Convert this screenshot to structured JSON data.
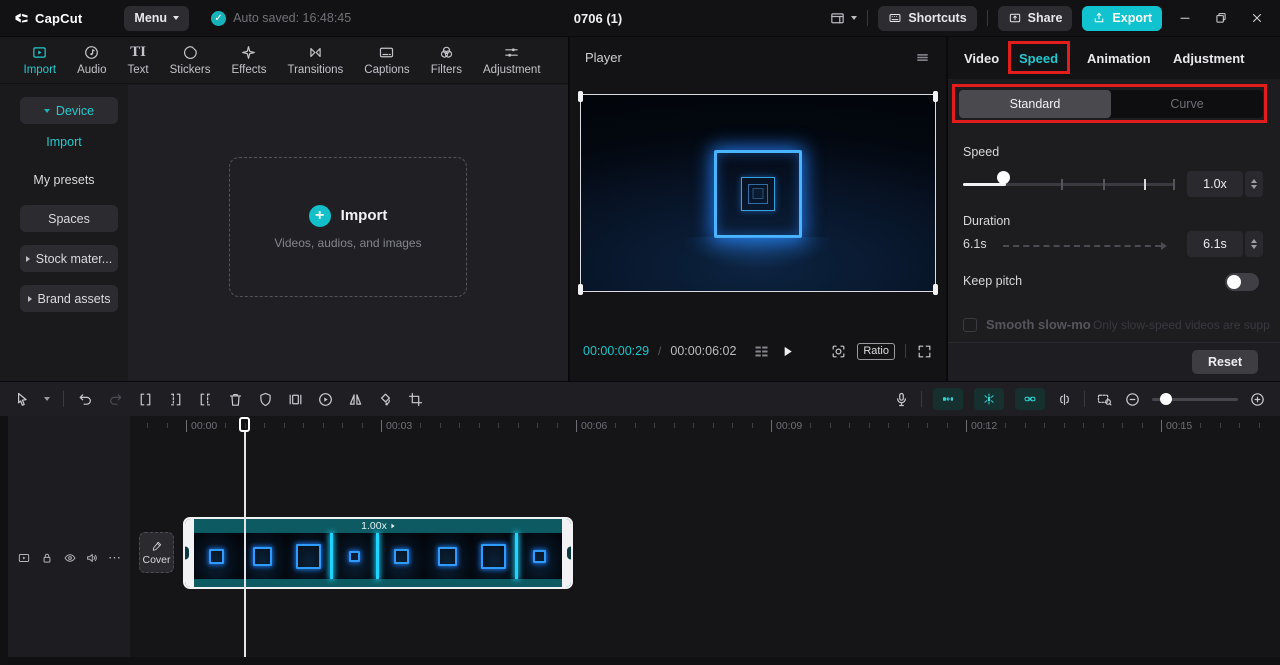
{
  "colors": {
    "accent": "#23c9ce",
    "export_button": "#10c3cf",
    "annotation_red": "#e31c1c",
    "clip_teal": "#0d5a63",
    "neon_blue": "#2f9bff"
  },
  "glyphs": {
    "check": "✓",
    "plus": "+",
    "text_icon": "TI",
    "more": "⋯"
  },
  "topbar": {
    "logo_text": "CapCut",
    "menu_label": "Menu",
    "autosave_text": "Auto saved: 16:48:45",
    "project_title": "0706 (1)",
    "shortcuts_label": "Shortcuts",
    "share_label": "Share",
    "export_label": "Export"
  },
  "media_panel": {
    "tabs": [
      {
        "label": "Import"
      },
      {
        "label": "Audio"
      },
      {
        "label": "Text"
      },
      {
        "label": "Stickers"
      },
      {
        "label": "Effects"
      },
      {
        "label": "Transitions"
      },
      {
        "label": "Captions"
      },
      {
        "label": "Filters"
      },
      {
        "label": "Adjustment"
      }
    ],
    "active_tab": "Import",
    "sidebar": {
      "device": "Device",
      "import": "Import",
      "my_presets": "My presets",
      "spaces": "Spaces",
      "stock": "Stock mater...",
      "brand": "Brand assets"
    },
    "dropzone": {
      "title": "Import",
      "subtitle": "Videos, audios, and images"
    }
  },
  "player": {
    "title": "Player",
    "current_time": "00:00:00:29",
    "time_separator": "/",
    "total_time": "00:00:06:02",
    "ratio_label": "Ratio"
  },
  "inspector": {
    "tabs": [
      {
        "label": "Video"
      },
      {
        "label": "Speed"
      },
      {
        "label": "Animation"
      },
      {
        "label": "Adjustment"
      }
    ],
    "active_tab": "Speed",
    "segmented": {
      "options": [
        {
          "label": "Standard"
        },
        {
          "label": "Curve"
        }
      ],
      "selected": "Standard"
    },
    "speed": {
      "label": "Speed",
      "value": "1.0x"
    },
    "duration": {
      "label": "Duration",
      "start_value": "6.1s",
      "value": "6.1s"
    },
    "keep_pitch": {
      "label": "Keep pitch",
      "enabled": false
    },
    "smooth": {
      "label": "Smooth slow-mo",
      "hint": "Only slow-speed videos are supp"
    },
    "reset_label": "Reset"
  },
  "timeline": {
    "ruler_labels": [
      "00:00",
      "00:03",
      "00:06",
      "00:09",
      "00:12",
      "00:15"
    ],
    "ruler_label_positions": [
      186,
      381,
      576,
      771,
      966,
      1161
    ],
    "clip": {
      "speed_label": "1.00x",
      "thumb_square_sizes": [
        15,
        19,
        25,
        11,
        15,
        19,
        25,
        13
      ],
      "separators_after": [
        2,
        3,
        6
      ]
    },
    "cover_label": "Cover"
  }
}
